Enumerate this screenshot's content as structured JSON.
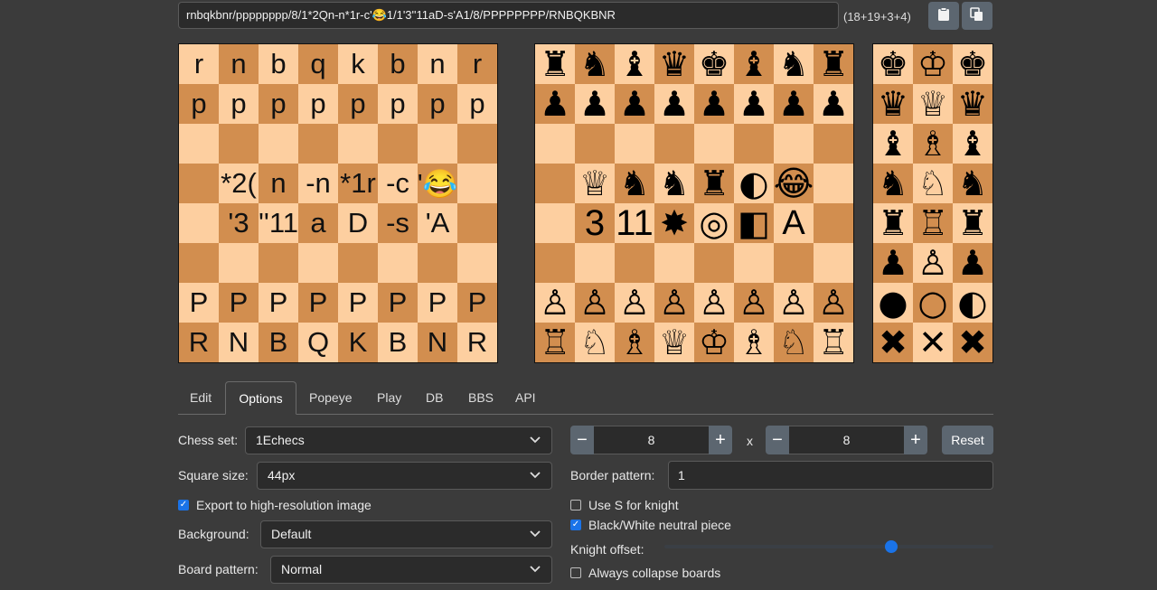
{
  "fen": {
    "value": "rnbqkbnr/pppppppp/8/1*2Qn-n*1r-c'😂1/1'3''11aD-s'A1/8/PPPPPPPP/RNBQKBNR",
    "count": "(18+19+3+4)"
  },
  "toolbar": {
    "copy_icon": "clipboard-icon",
    "copy_image_icon": "copy-icon"
  },
  "boards": {
    "text_board": {
      "rows": [
        [
          "r",
          "n",
          "b",
          "q",
          "k",
          "b",
          "n",
          "r"
        ],
        [
          "p",
          "p",
          "p",
          "p",
          "p",
          "p",
          "p",
          "p"
        ],
        [
          "",
          "",
          "",
          "",
          "",
          "",
          "",
          ""
        ],
        [
          "",
          "*2(",
          "n",
          "-n",
          "*1r",
          "-c",
          "'😂",
          ""
        ],
        [
          "",
          "'3",
          "''11",
          "a",
          "D",
          "-s",
          "'A",
          ""
        ],
        [
          "",
          "",
          "",
          "",
          "",
          "",
          "",
          ""
        ],
        [
          "P",
          "P",
          "P",
          "P",
          "P",
          "P",
          "P",
          "P"
        ],
        [
          "R",
          "N",
          "B",
          "Q",
          "K",
          "B",
          "N",
          "R"
        ]
      ]
    },
    "piece_board": {
      "rows": [
        [
          "♜",
          "♞",
          "♝",
          "♛",
          "♚",
          "♝",
          "♞",
          "♜"
        ],
        [
          "♟",
          "♟",
          "♟",
          "♟",
          "♟",
          "♟",
          "♟",
          "♟"
        ],
        [
          "",
          "",
          "",
          "",
          "",
          "",
          "",
          ""
        ],
        [
          "",
          "♕",
          "♞",
          "♞",
          "♜",
          "◐",
          "😂",
          ""
        ],
        [
          "",
          "3",
          "11",
          "✸",
          "◎",
          "◧",
          "A",
          ""
        ],
        [
          "",
          "",
          "",
          "",
          "",
          "",
          "",
          ""
        ],
        [
          "♙",
          "♙",
          "♙",
          "♙",
          "♙",
          "♙",
          "♙",
          "♙"
        ],
        [
          "♖",
          "♘",
          "♗",
          "♕",
          "♔",
          "♗",
          "♘",
          "♖"
        ]
      ]
    },
    "palette_board": {
      "rows": [
        [
          "♚",
          "♔",
          "♚"
        ],
        [
          "♛",
          "♕",
          "♛"
        ],
        [
          "♝",
          "♗",
          "♝"
        ],
        [
          "♞",
          "♘",
          "♞"
        ],
        [
          "♜",
          "♖",
          "♜"
        ],
        [
          "♟",
          "♙",
          "♟"
        ],
        [
          "●",
          "○",
          "◐"
        ],
        [
          "✖",
          "✕",
          "✖"
        ]
      ]
    }
  },
  "tabs": [
    "Edit",
    "Options",
    "Popeye",
    "Play",
    "DB",
    "BBS",
    "API"
  ],
  "options": {
    "chess_set_label": "Chess set:",
    "chess_set_value": "1Echecs",
    "square_size_label": "Square size:",
    "square_size_value": "44px",
    "export_label": "Export to high-resolution image",
    "export_checked": true,
    "background_label": "Background:",
    "background_value": "Default",
    "board_pattern_label": "Board pattern:",
    "board_pattern_value": "Normal",
    "width_value": "8",
    "height_value": "8",
    "x_label": "x",
    "reset_label": "Reset",
    "border_pattern_label": "Border pattern:",
    "border_pattern_value": "1",
    "use_s_label": "Use S for knight",
    "use_s_checked": false,
    "bw_neutral_label": "Black/White neutral piece",
    "bw_neutral_checked": true,
    "knight_offset_label": "Knight offset:",
    "knight_offset_fraction": 0.69,
    "collapse_label": "Always collapse boards",
    "collapse_checked": false
  },
  "colors": {
    "light_square": "#fdcfa0",
    "dark_square": "#d28e4f",
    "accent": "#1a73e8",
    "background": "#3b3b3b"
  }
}
